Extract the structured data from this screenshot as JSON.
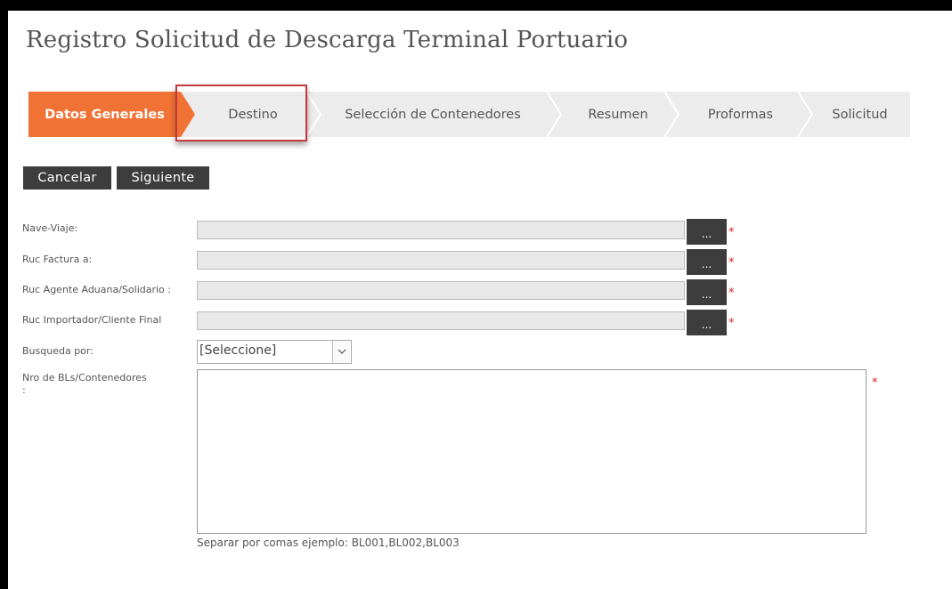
{
  "page": {
    "title": "Registro Solicitud de Descarga Terminal Portuario"
  },
  "wizard": {
    "steps": [
      {
        "label": "Datos Generales",
        "active": true
      },
      {
        "label": "Destino",
        "active": false
      },
      {
        "label": "Selección de Contenedores",
        "active": false
      },
      {
        "label": "Resumen",
        "active": false
      },
      {
        "label": "Proformas",
        "active": false
      },
      {
        "label": "Solicitud",
        "active": false
      }
    ],
    "active_color": "#f07234"
  },
  "actions": {
    "cancel_label": "Cancelar",
    "next_label": "Siguiente"
  },
  "form": {
    "nave_viaje": {
      "label": "Nave-Viaje:",
      "value": "",
      "lookup": "..."
    },
    "ruc_factura": {
      "label": "Ruc Factura a:",
      "value": "",
      "lookup": "..."
    },
    "ruc_agente": {
      "label": "Ruc Agente Aduana/Solidario :",
      "value": "",
      "lookup": "..."
    },
    "ruc_importador": {
      "label": "Ruc Importador/Cliente Final",
      "value": "",
      "lookup": "..."
    },
    "busqueda": {
      "label": "Busqueda por:",
      "selected": "[Seleccione]"
    },
    "nro_bls": {
      "label_line1": "Nro de BLs/Contenedores",
      "label_line2": ":",
      "value": ""
    },
    "required_mark": "*",
    "hint": "Separar por comas ejemplo: BL001,BL002,BL003"
  }
}
